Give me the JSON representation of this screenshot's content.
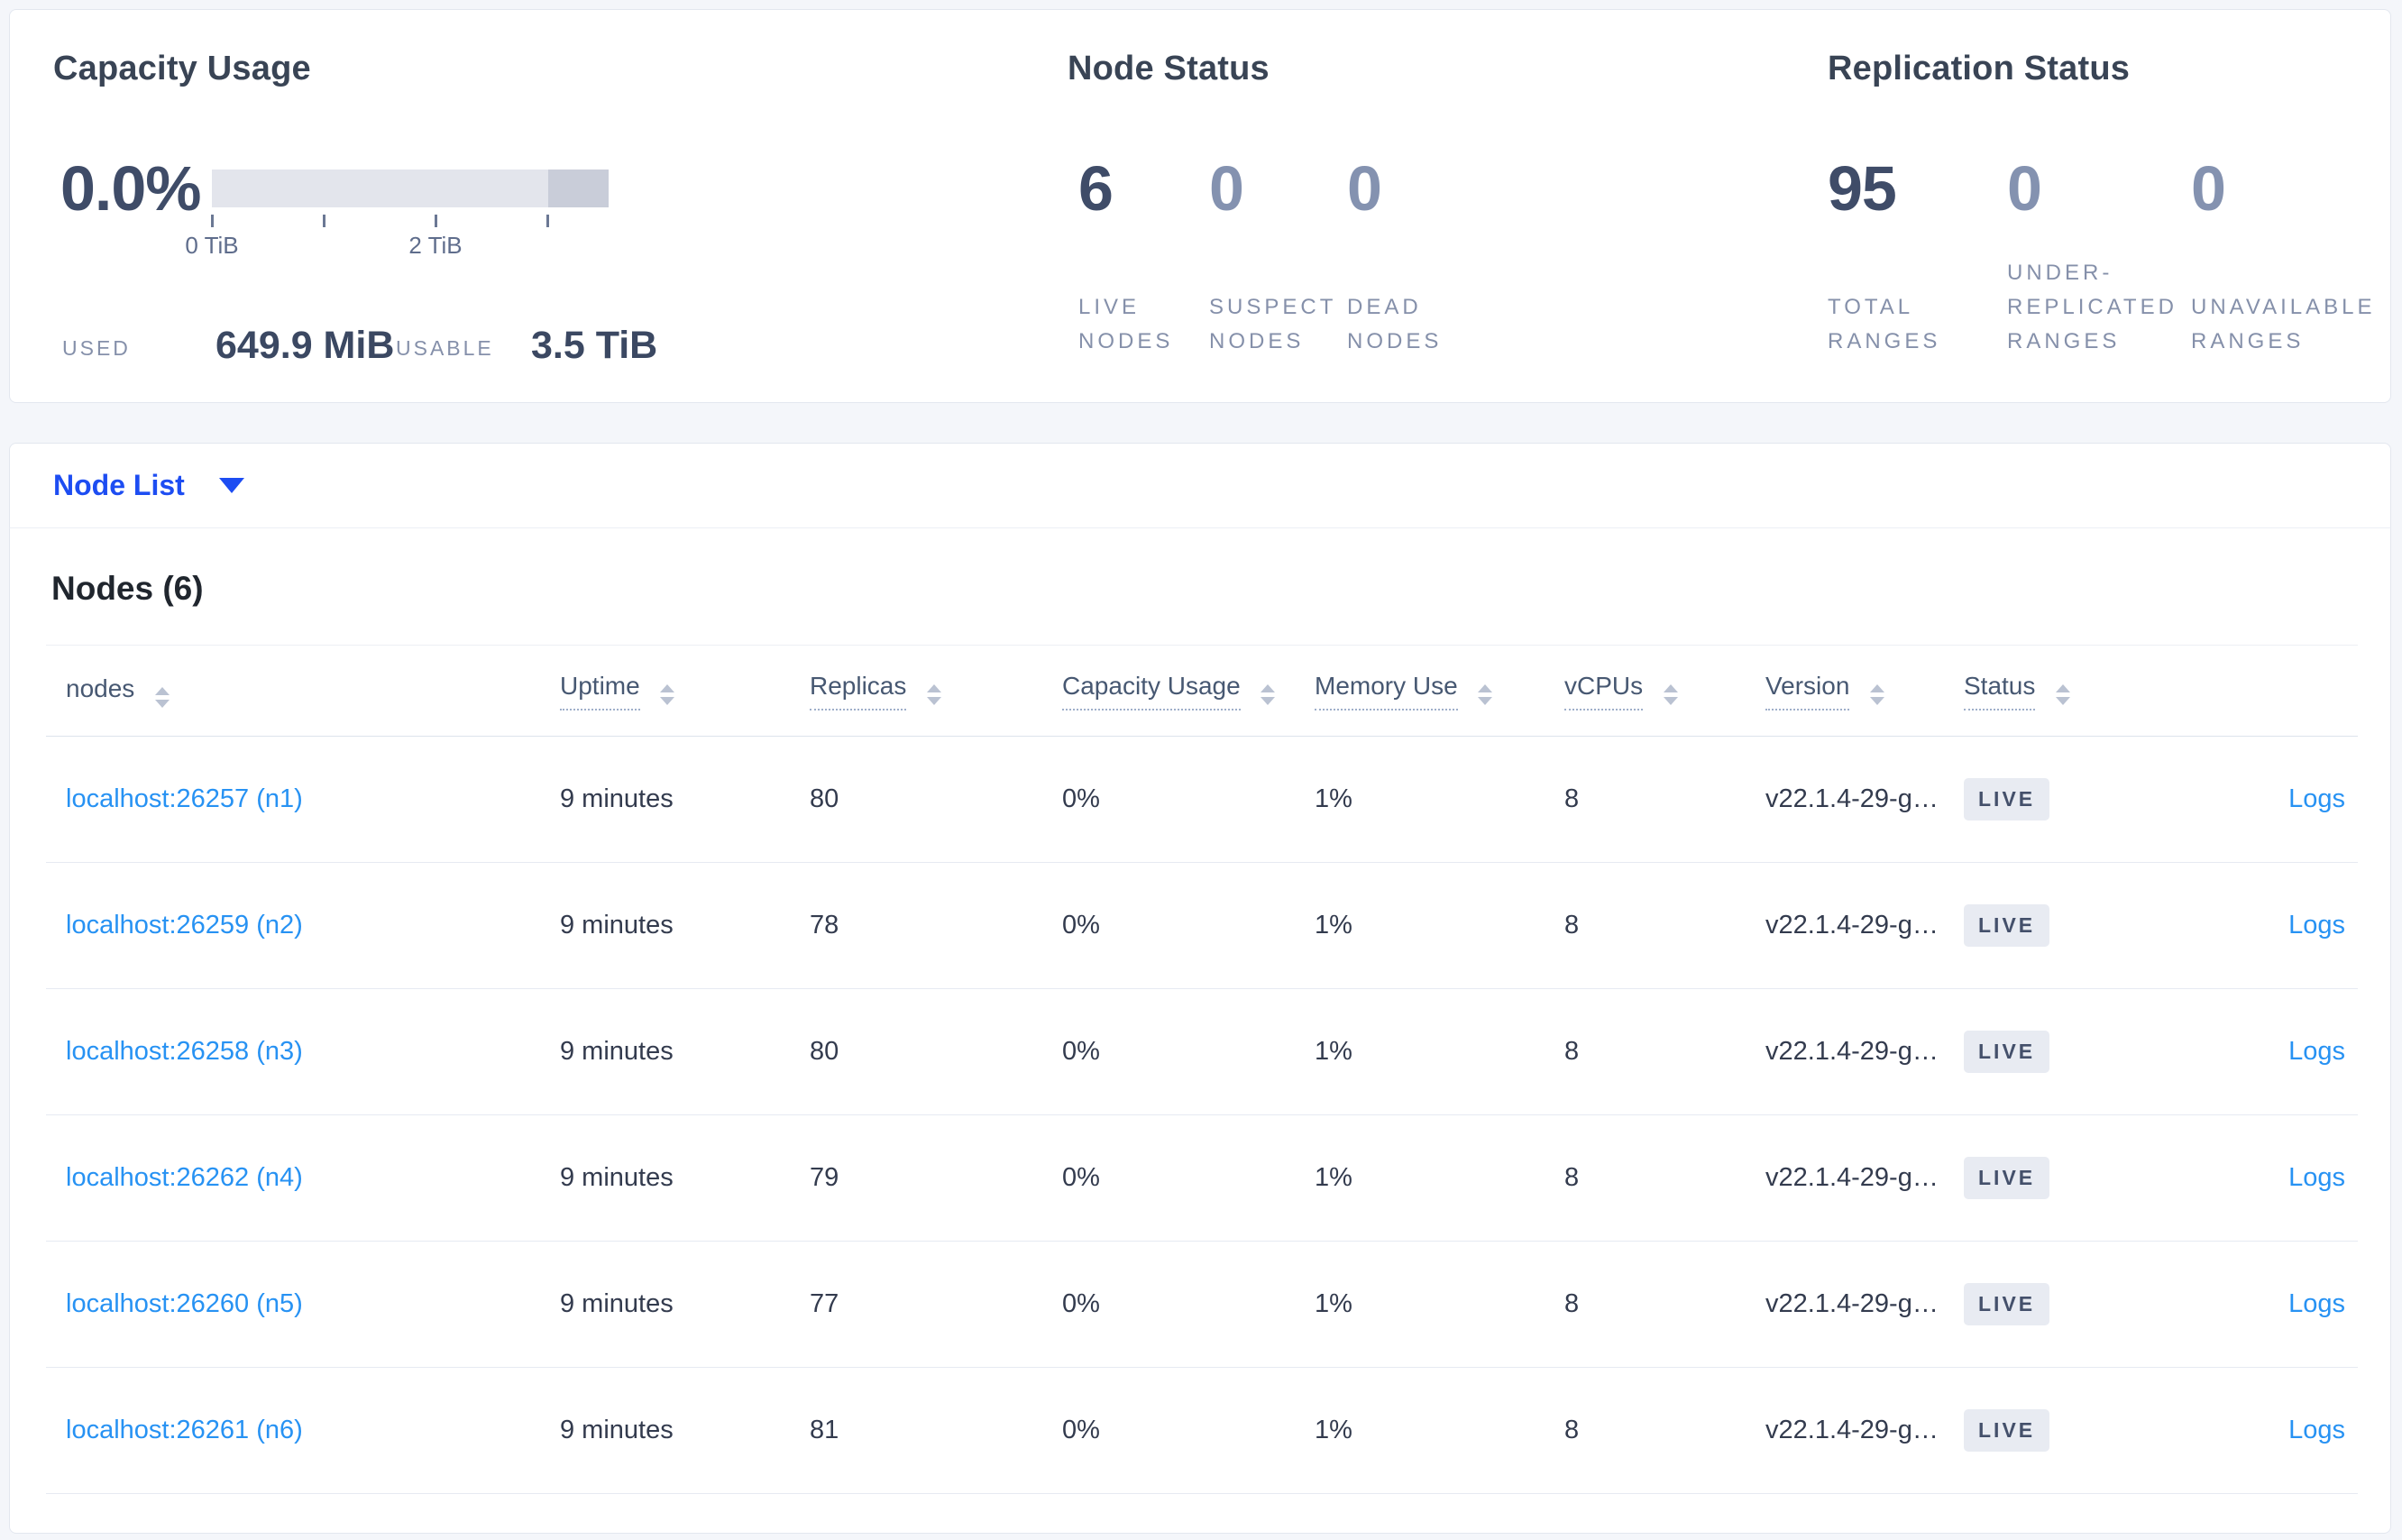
{
  "summary": {
    "capacity": {
      "title": "Capacity Usage",
      "percent": "0.0%",
      "tick_labels": [
        "0 TiB",
        "2 TiB"
      ],
      "used_label": "USED",
      "used_value": "649.9 MiB",
      "usable_label": "USABLE",
      "usable_value": "3.5 TiB"
    },
    "node_status": {
      "title": "Node Status",
      "stats": [
        {
          "value": "6",
          "label": "LIVE NODES"
        },
        {
          "value": "0",
          "label": "SUSPECT NODES"
        },
        {
          "value": "0",
          "label": "DEAD NODES"
        }
      ]
    },
    "replication": {
      "title": "Replication Status",
      "stats": [
        {
          "value": "95",
          "label": "TOTAL RANGES"
        },
        {
          "value": "0",
          "label": "UNDER-REPLICATED RANGES"
        },
        {
          "value": "0",
          "label": "UNAVAILABLE RANGES"
        }
      ]
    }
  },
  "view_selector": {
    "label": "Node List"
  },
  "nodes_section": {
    "title": "Nodes (6)",
    "columns": [
      {
        "label": "nodes"
      },
      {
        "label": "Uptime"
      },
      {
        "label": "Replicas"
      },
      {
        "label": "Capacity Usage"
      },
      {
        "label": "Memory Use"
      },
      {
        "label": "vCPUs"
      },
      {
        "label": "Version"
      },
      {
        "label": "Status"
      },
      {
        "label": ""
      }
    ],
    "rows": [
      {
        "address": "localhost:26257 (n1)",
        "uptime": "9 minutes",
        "replicas": "80",
        "capacity": "0%",
        "memory": "1%",
        "vcpus": "8",
        "version": "v22.1.4-29-g…",
        "status": "LIVE",
        "logs": "Logs"
      },
      {
        "address": "localhost:26259 (n2)",
        "uptime": "9 minutes",
        "replicas": "78",
        "capacity": "0%",
        "memory": "1%",
        "vcpus": "8",
        "version": "v22.1.4-29-g…",
        "status": "LIVE",
        "logs": "Logs"
      },
      {
        "address": "localhost:26258 (n3)",
        "uptime": "9 minutes",
        "replicas": "80",
        "capacity": "0%",
        "memory": "1%",
        "vcpus": "8",
        "version": "v22.1.4-29-g…",
        "status": "LIVE",
        "logs": "Logs"
      },
      {
        "address": "localhost:26262 (n4)",
        "uptime": "9 minutes",
        "replicas": "79",
        "capacity": "0%",
        "memory": "1%",
        "vcpus": "8",
        "version": "v22.1.4-29-g…",
        "status": "LIVE",
        "logs": "Logs"
      },
      {
        "address": "localhost:26260 (n5)",
        "uptime": "9 minutes",
        "replicas": "77",
        "capacity": "0%",
        "memory": "1%",
        "vcpus": "8",
        "version": "v22.1.4-29-g…",
        "status": "LIVE",
        "logs": "Logs"
      },
      {
        "address": "localhost:26261 (n6)",
        "uptime": "9 minutes",
        "replicas": "81",
        "capacity": "0%",
        "memory": "1%",
        "vcpus": "8",
        "version": "v22.1.4-29-g…",
        "status": "LIVE",
        "logs": "Logs"
      }
    ]
  },
  "colors": {
    "page_background": "#f4f6fa",
    "selector_blue": "#1d4df2",
    "link_blue": "#2792f3",
    "heading_slate": "#394455",
    "stat_muted": "#8492b0",
    "bar_track": "#e3e5ec",
    "bar_segment": "#c9cdd9",
    "badge_background": "#e8ebf2"
  }
}
